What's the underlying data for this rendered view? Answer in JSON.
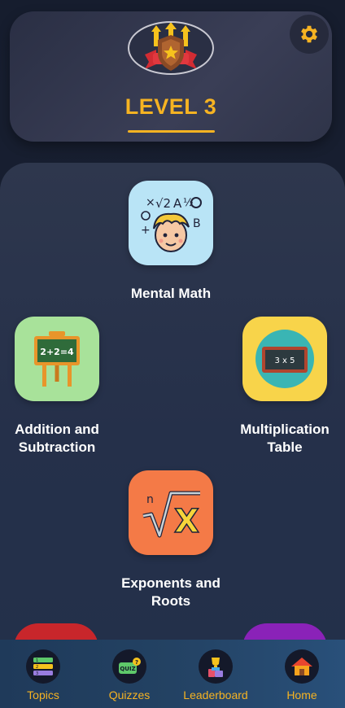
{
  "header": {
    "level_title": "LEVEL 3"
  },
  "topics": [
    {
      "label": "Mental Math",
      "color": "#b9e4f6"
    },
    {
      "label": "Addition and\nSubtraction",
      "color": "#a8e29a"
    },
    {
      "label": "Multiplication\nTable",
      "color": "#f8d44a"
    },
    {
      "label": "Exponents and\nRoots",
      "color": "#f47a47"
    }
  ],
  "board_text": {
    "addition": "2+2=4",
    "multiplication": "3 x 5"
  },
  "peek_tiles": [
    {
      "color": "#c8262b"
    },
    {
      "color": "#8a22b8"
    }
  ],
  "nav": [
    {
      "label": "Topics",
      "icon": "list-icon"
    },
    {
      "label": "Quizzes",
      "icon": "quiz-icon"
    },
    {
      "label": "Leaderboard",
      "icon": "trophy-icon"
    },
    {
      "label": "Home",
      "icon": "home-icon"
    }
  ],
  "colors": {
    "accent": "#f6b322",
    "background": "#1a2133",
    "nav_background": "#234263"
  }
}
